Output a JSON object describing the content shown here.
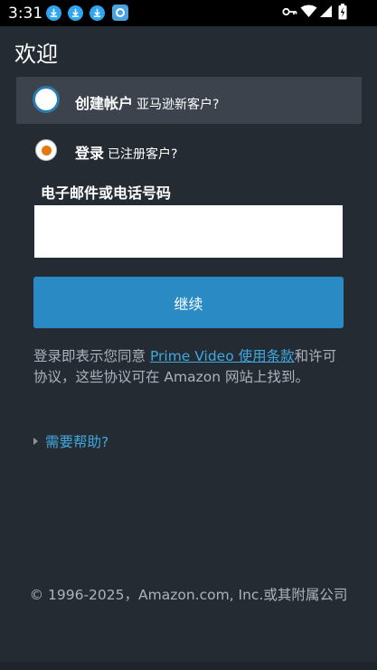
{
  "status_bar": {
    "time": "3:31",
    "left_icons": [
      "download-icon",
      "download-icon",
      "download-icon",
      "app-icon"
    ],
    "right_icons": [
      "key-icon",
      "wifi-icon",
      "signal-icon",
      "battery-charging-icon"
    ]
  },
  "page": {
    "title": "欢迎"
  },
  "create_account": {
    "label": "创建帐户",
    "sub": "亚马逊新客户?"
  },
  "sign_in": {
    "label": "登录",
    "sub": "已注册客户?"
  },
  "form": {
    "field_label": "电子邮件或电话号码",
    "field_value": "",
    "continue_label": "继续"
  },
  "legal": {
    "prefix": "登录即表示您同意 ",
    "link": "Prime Video 使用条款",
    "suffix": "和许可协议，这些协议可在 Amazon 网站上找到。"
  },
  "help": {
    "label": "需要帮助?"
  },
  "footer": {
    "copyright": "© 1996-2025，Amazon.com, Inc.或其附属公司"
  },
  "colors": {
    "accent": "#2a8bc4",
    "link": "#3ea9e0",
    "radio_selected": "#e47911",
    "background": "#252b33"
  }
}
